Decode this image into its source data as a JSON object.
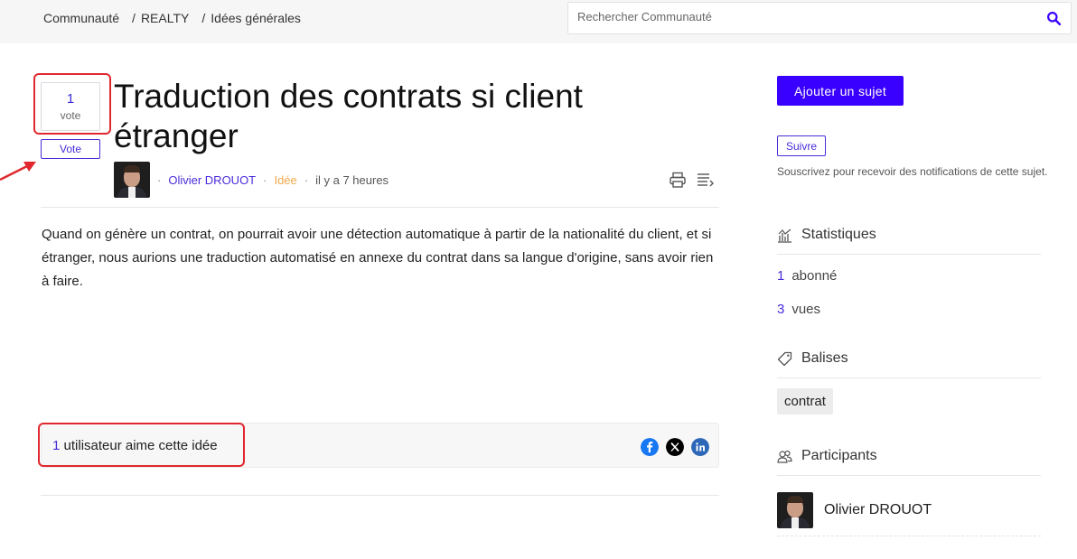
{
  "breadcrumb": {
    "items": [
      "Communauté",
      "REALTY",
      "Idées générales"
    ],
    "separator": "/"
  },
  "search": {
    "placeholder": "Rechercher Communauté",
    "value": ""
  },
  "vote": {
    "count": "1",
    "label": "vote",
    "button": "Vote"
  },
  "post": {
    "title": "Traduction des contrats si client étranger",
    "author": "Olivier DROUOT",
    "type": "Idée",
    "time": "il y a 7 heures",
    "body": "Quand on génère un contrat, on pourrait avoir une détection automatique à partir de la nationalité du client, et si étranger, nous aurions une traduction automatisé en annexe du contrat dans sa langue d'origine, sans avoir rien à faire."
  },
  "likes": {
    "count": "1",
    "text": "utilisateur aime cette idée"
  },
  "share": [
    "facebook-icon",
    "x-icon",
    "linkedin-icon"
  ],
  "sidebar": {
    "add_topic": "Ajouter un sujet",
    "follow": "Suivre",
    "follow_desc": "Souscrivez pour recevoir des notifications de cette sujet.",
    "stats_title": "Statistiques",
    "stats": [
      {
        "n": "1",
        "label": "abonné"
      },
      {
        "n": "3",
        "label": "vues"
      }
    ],
    "tags_title": "Balises",
    "tags": [
      "contrat"
    ],
    "participants_title": "Participants",
    "participants": [
      "Olivier DROUOT"
    ]
  },
  "colors": {
    "accent": "#3a00ff",
    "link": "#4a2bd8",
    "idea": "#f0a84a",
    "highlight": "#e0282e"
  }
}
